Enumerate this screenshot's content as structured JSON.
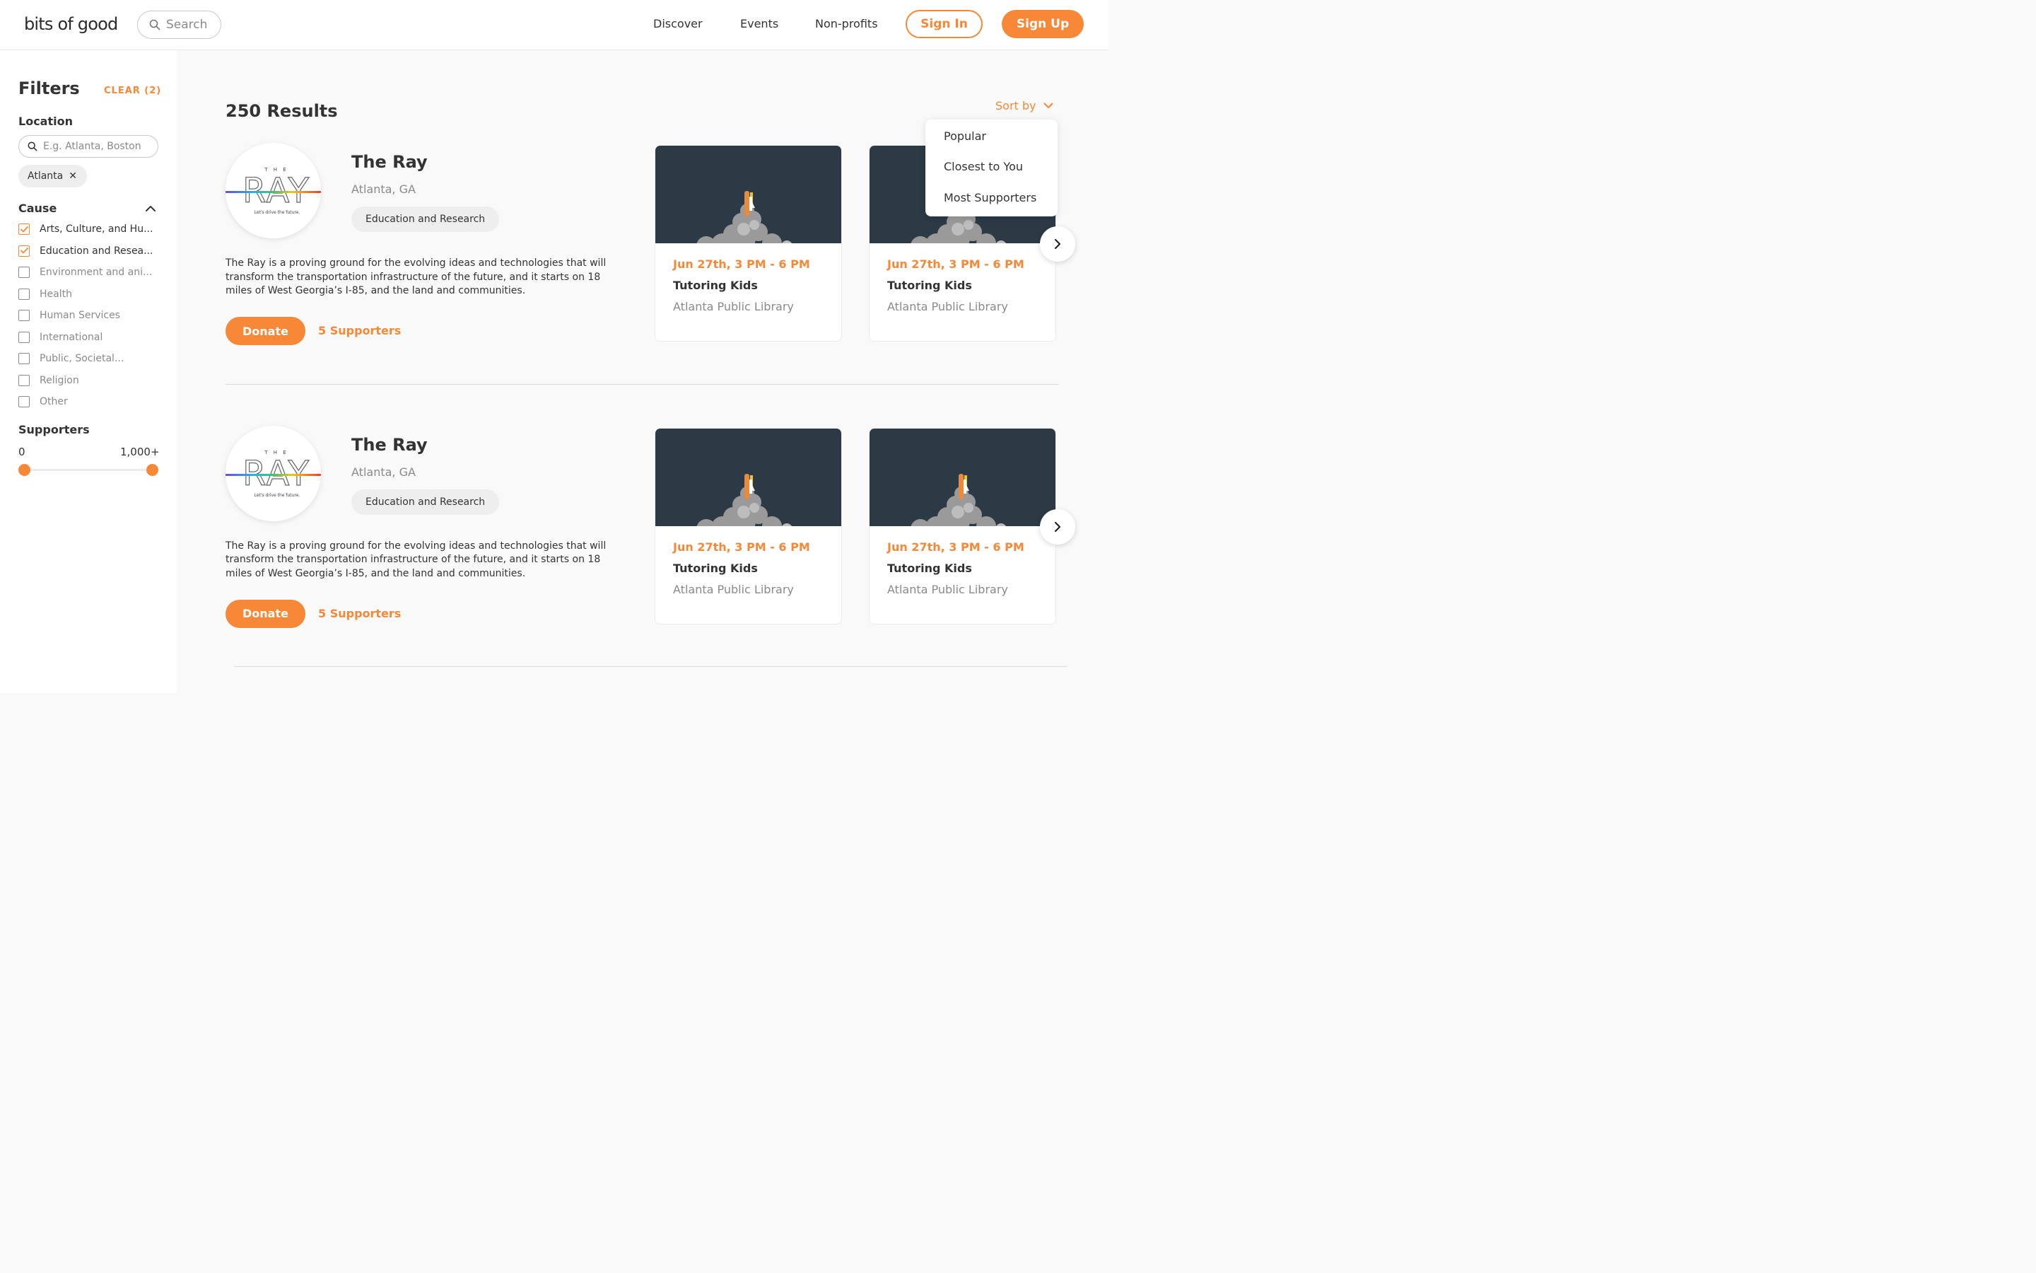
{
  "header": {
    "logo": "bits of good",
    "search_placeholder": "Search",
    "nav": [
      "Discover",
      "Events",
      "Non-profits"
    ],
    "sign_in": "Sign In",
    "sign_up": "Sign Up"
  },
  "sidebar": {
    "title": "Filters",
    "clear": "CLEAR (2)",
    "location_label": "Location",
    "location_placeholder": "E.g. Atlanta, Boston",
    "location_chip": "Atlanta",
    "cause_label": "Cause",
    "causes": [
      {
        "label": "Arts, Culture, and Hu...",
        "checked": true
      },
      {
        "label": "Education and Resea...",
        "checked": true
      },
      {
        "label": "Environment and ani...",
        "checked": false
      },
      {
        "label": "Health",
        "checked": false
      },
      {
        "label": "Human Services",
        "checked": false
      },
      {
        "label": "International",
        "checked": false
      },
      {
        "label": "Public, Societal...",
        "checked": false
      },
      {
        "label": "Religion",
        "checked": false
      },
      {
        "label": "Other",
        "checked": false
      }
    ],
    "supporters_label": "Supporters",
    "range_min": "0",
    "range_max": "1,000+"
  },
  "main": {
    "results": "250 Results",
    "sort_label": "Sort by",
    "sort_options": [
      "Popular",
      "Closest to You",
      "Most Supporters"
    ],
    "orgs": [
      {
        "name": "The Ray",
        "location": "Atlanta, GA",
        "tag": "Education and Research",
        "description": "The Ray is a proving ground for the evolving ideas and technologies that will transform the transportation infrastructure of the future, and it starts on 18 miles of West Georgia’s I-85, and the land and communities.",
        "donate": "Donate",
        "supporters": "5 Supporters",
        "logo_top": "T H E",
        "logo_word": "RAY",
        "logo_tagline": "Let's drive the future.",
        "events": [
          {
            "date": "Jun 27th, 3 PM - 6 PM",
            "title": "Tutoring Kids",
            "place": "Atlanta Public Library"
          },
          {
            "date": "Jun 27th, 3 PM - 6 PM",
            "title": "Tutoring Kids",
            "place": "Atlanta Public Library"
          }
        ]
      },
      {
        "name": "The Ray",
        "location": "Atlanta, GA",
        "tag": "Education and Research",
        "description": "The Ray is a proving ground for the evolving ideas and technologies that will transform the transportation infrastructure of the future, and it starts on 18 miles of West Georgia’s I-85, and the land and communities.",
        "donate": "Donate",
        "supporters": "5 Supporters",
        "logo_top": "T H E",
        "logo_word": "RAY",
        "logo_tagline": "Let's drive the future.",
        "events": [
          {
            "date": "Jun 27th, 3 PM - 6 PM",
            "title": "Tutoring Kids",
            "place": "Atlanta Public Library"
          },
          {
            "date": "Jun 27th, 3 PM - 6 PM",
            "title": "Tutoring Kids",
            "place": "Atlanta Public Library"
          }
        ]
      }
    ]
  },
  "colors": {
    "accent": "#f68837",
    "card_image_bg": "#2b3a45",
    "muted_text": "#8a8a8a"
  },
  "icons": [
    "search-icon",
    "close-icon",
    "chevron-up-icon",
    "chevron-down-icon",
    "chevron-right-icon",
    "checkmark-icon",
    "rocket-icon"
  ]
}
